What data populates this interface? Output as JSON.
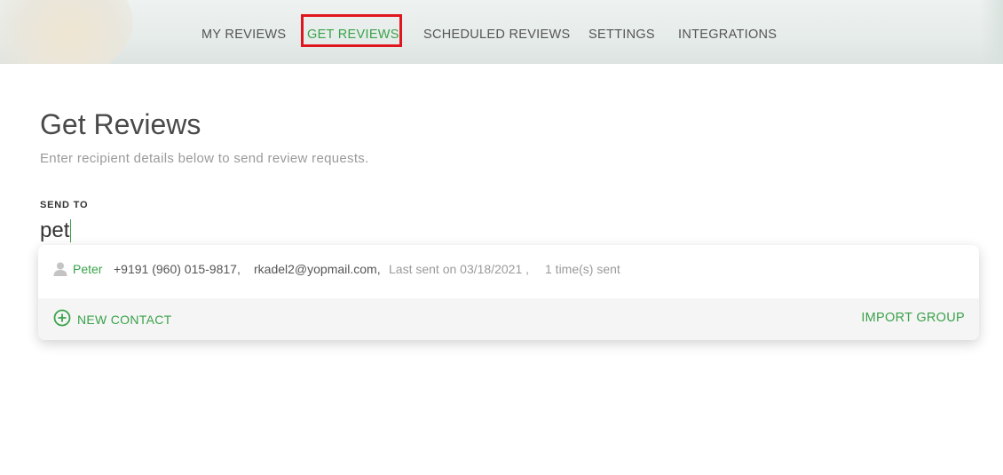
{
  "nav": {
    "items": [
      {
        "label": "MY REVIEWS"
      },
      {
        "label": "GET REVIEWS"
      },
      {
        "label": "SCHEDULED REVIEWS"
      },
      {
        "label": "SETTINGS"
      },
      {
        "label": "INTEGRATIONS"
      }
    ],
    "active_index": 1
  },
  "page": {
    "title": "Get Reviews",
    "subtitle": "Enter recipient details below to send review requests."
  },
  "send_to": {
    "label": "SEND TO",
    "value": "pet"
  },
  "suggestions": [
    {
      "icon": "person-icon",
      "name": "Peter",
      "phone": "+9191 (960) 015-9817,",
      "email": "rkadel2@yopmail.com,",
      "last_sent": "Last sent on 03/18/2021 ,",
      "times_sent": "1 time(s) sent"
    }
  ],
  "dropdown_footer": {
    "new_contact_icon": "plus-circle-icon",
    "new_contact_label": "NEW CONTACT",
    "import_group_label": "IMPORT GROUP"
  },
  "colors": {
    "accent": "#3aa24a",
    "highlight_box": "#e0161f"
  }
}
